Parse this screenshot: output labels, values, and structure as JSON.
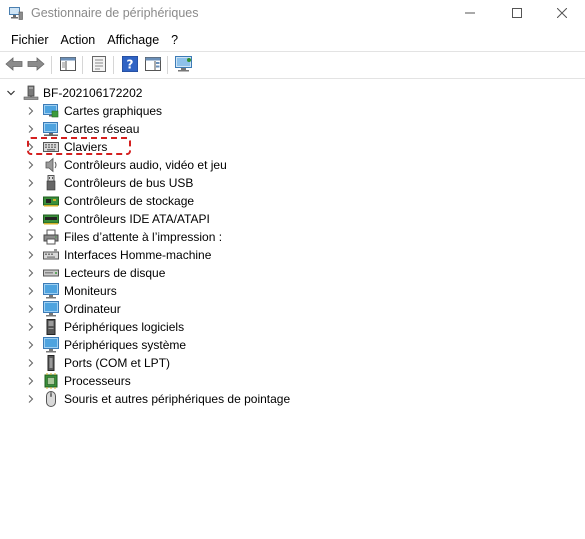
{
  "window": {
    "title": "Gestionnaire de périphériques",
    "controls": [
      "minimize-icon",
      "maximize-icon",
      "close-icon"
    ]
  },
  "menu": {
    "items": [
      "Fichier",
      "Action",
      "Affichage",
      "?"
    ]
  },
  "toolbar": {
    "buttons": [
      "back-arrow-icon",
      "forward-arrow-icon",
      "show-hide-pane-icon",
      "properties-icon",
      "help-icon",
      "action-pane-icon",
      "scan-hardware-monitor-icon"
    ]
  },
  "tree": {
    "root": {
      "label": "BF-20210617220​2",
      "expanded": true,
      "icon": "computer-tower-icon"
    },
    "categories": [
      {
        "label": "Cartes graphiques",
        "icon": "display-adapter-icon"
      },
      {
        "label": "Cartes réseau",
        "icon": "network-adapter-icon"
      },
      {
        "label": "Claviers",
        "icon": "keyboard-icon",
        "highlighted": true
      },
      {
        "label": "Contrôleurs audio, vidéo et jeu",
        "icon": "speaker-icon"
      },
      {
        "label": "Contrôleurs de bus USB",
        "icon": "usb-icon"
      },
      {
        "label": "Contrôleurs de stockage",
        "icon": "storage-controller-icon"
      },
      {
        "label": "Contrôleurs IDE ATA/ATAPI",
        "icon": "ide-controller-icon"
      },
      {
        "label": "Files d’attente à l’impression :",
        "icon": "print-queue-icon"
      },
      {
        "label": "Interfaces Homme-machine",
        "icon": "hid-icon"
      },
      {
        "label": "Lecteurs de disque",
        "icon": "disk-drive-icon"
      },
      {
        "label": "Moniteurs",
        "icon": "monitor-icon"
      },
      {
        "label": "Ordinateur",
        "icon": "computer-icon"
      },
      {
        "label": "Périphériques logiciels",
        "icon": "software-device-icon"
      },
      {
        "label": "Périphériques système",
        "icon": "system-device-icon"
      },
      {
        "label": "Ports (COM et LPT)",
        "icon": "port-icon"
      },
      {
        "label": "Processeurs",
        "icon": "processor-icon"
      },
      {
        "label": "Souris et autres périphériques de pointage",
        "icon": "mouse-icon"
      }
    ]
  },
  "colors": {
    "highlight_border": "#d42020",
    "title_text": "#8a8a8a",
    "help_blue": "#2f63c4"
  }
}
